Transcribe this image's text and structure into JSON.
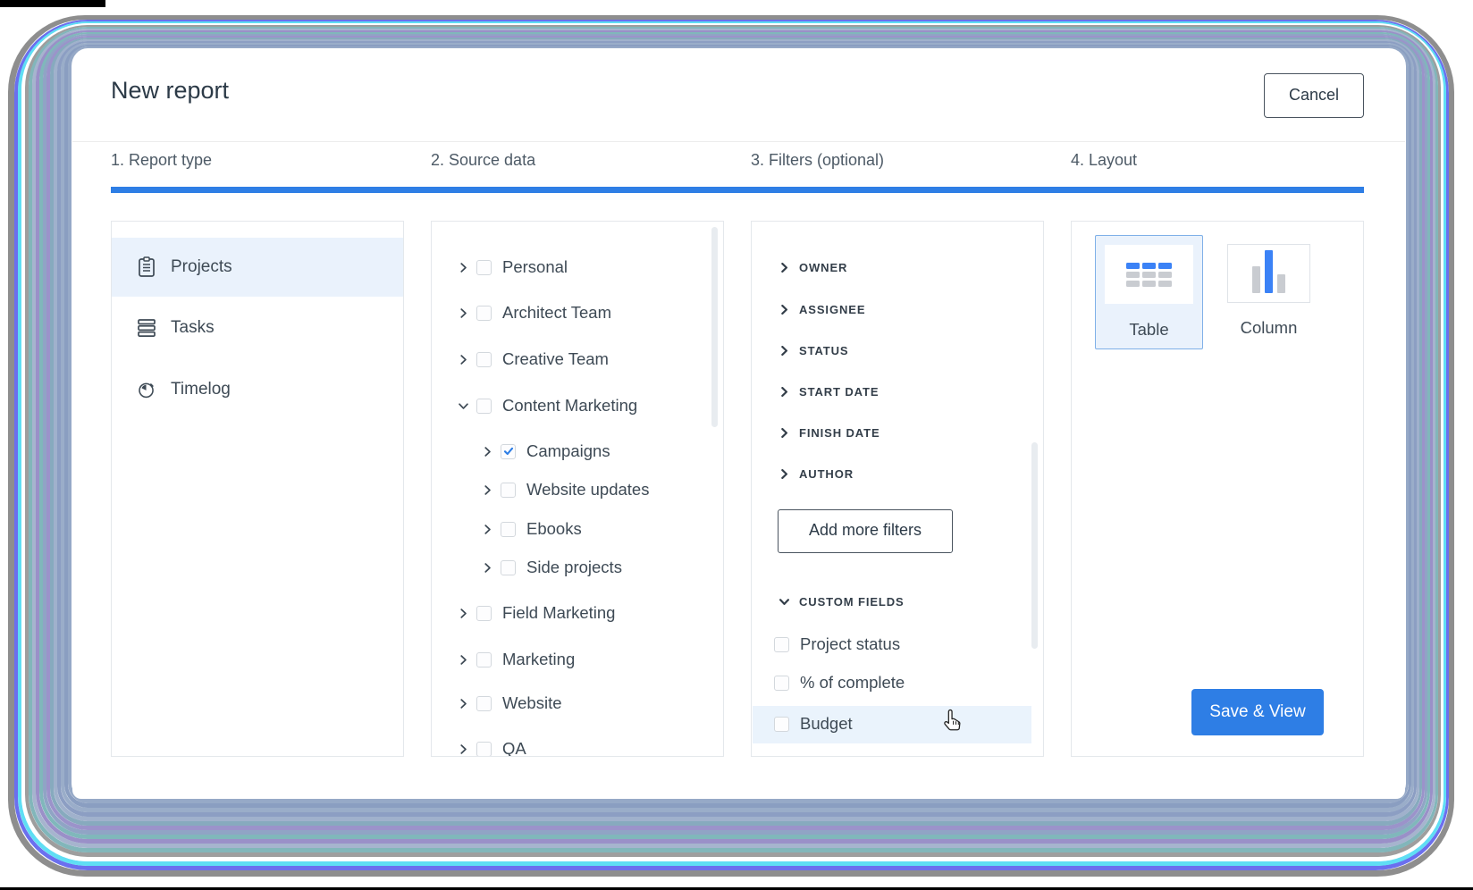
{
  "header": {
    "title": "New report",
    "cancel_label": "Cancel"
  },
  "steps": [
    {
      "label": "1. Report type"
    },
    {
      "label": "2. Source data"
    },
    {
      "label": "3. Filters (optional)"
    },
    {
      "label": "4. Layout"
    }
  ],
  "report_type": {
    "items": [
      {
        "label": "Projects",
        "icon": "projects-icon",
        "selected": true
      },
      {
        "label": "Tasks",
        "icon": "tasks-icon",
        "selected": false
      },
      {
        "label": "Timelog",
        "icon": "timelog-icon",
        "selected": false
      }
    ]
  },
  "source_data": {
    "items": [
      {
        "label": "Personal",
        "level": 0,
        "expanded": false,
        "checked": false
      },
      {
        "label": "Architect Team",
        "level": 0,
        "expanded": false,
        "checked": false
      },
      {
        "label": "Creative Team",
        "level": 0,
        "expanded": false,
        "checked": false
      },
      {
        "label": "Content Marketing",
        "level": 0,
        "expanded": true,
        "checked": false
      },
      {
        "label": "Campaigns",
        "level": 1,
        "expanded": false,
        "checked": true
      },
      {
        "label": "Website updates",
        "level": 1,
        "expanded": false,
        "checked": false
      },
      {
        "label": "Ebooks",
        "level": 1,
        "expanded": false,
        "checked": false
      },
      {
        "label": "Side projects",
        "level": 1,
        "expanded": false,
        "checked": false
      },
      {
        "label": "Field Marketing",
        "level": 0,
        "expanded": false,
        "checked": false
      },
      {
        "label": "Marketing",
        "level": 0,
        "expanded": false,
        "checked": false
      },
      {
        "label": "Website",
        "level": 0,
        "expanded": false,
        "checked": false
      },
      {
        "label": "QA",
        "level": 0,
        "expanded": false,
        "checked": false
      }
    ]
  },
  "filters": {
    "groups": [
      {
        "label": "OWNER"
      },
      {
        "label": "ASSIGNEE"
      },
      {
        "label": "STATUS"
      },
      {
        "label": "START DATE"
      },
      {
        "label": "FINISH DATE"
      },
      {
        "label": "AUTHOR"
      }
    ],
    "add_more_label": "Add more filters",
    "custom_fields": {
      "label": "CUSTOM FIELDS",
      "expanded": true,
      "items": [
        {
          "label": "Project status",
          "checked": false
        },
        {
          "label": "% of complete",
          "checked": false
        },
        {
          "label": "Budget",
          "checked": false,
          "hovered": true
        }
      ]
    }
  },
  "layout": {
    "options": [
      {
        "label": "Table",
        "icon": "table-icon",
        "selected": true
      },
      {
        "label": "Column",
        "icon": "column-chart-icon",
        "selected": false
      }
    ],
    "save_label": "Save & View"
  },
  "colors": {
    "accent_blue": "#2e7ee5",
    "icon_blue": "#3b82f6",
    "selected_row_bg": "#eaf2fc",
    "icon_gray": "#c9ccd1"
  }
}
